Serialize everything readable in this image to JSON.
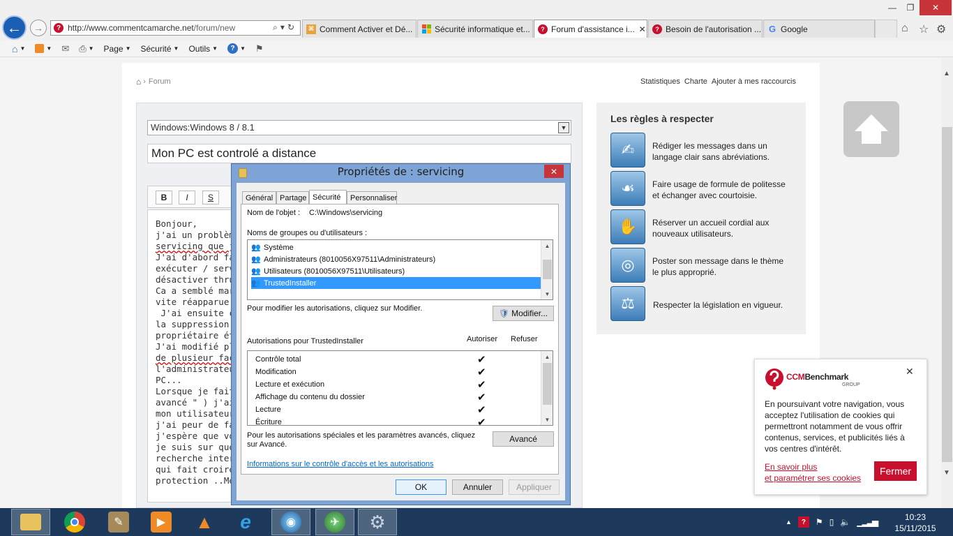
{
  "browser": {
    "window_controls": [
      "—",
      "❐",
      "✕"
    ],
    "address": "http://www.commentcamarche.net/forum/new",
    "address_display_host": "http://www.commentcamarche.net",
    "address_display_path": "/forum/new",
    "tabs": [
      {
        "label": "Comment Activer et Dé...",
        "icon": "ccm-tab-icon",
        "active": false
      },
      {
        "label": "Sécurité informatique et...",
        "icon": "windows-flag-icon",
        "active": false
      },
      {
        "label": "Forum d'assistance i...",
        "icon": "ccm-question-icon",
        "active": true
      },
      {
        "label": "Besoin de l'autorisation ...",
        "icon": "ccm-question-icon",
        "active": false
      },
      {
        "label": "Google",
        "icon": "google-icon",
        "active": false
      }
    ],
    "command_bar": {
      "page": "Page",
      "security": "Sécurité",
      "tools": "Outils"
    }
  },
  "page": {
    "breadcrumb": "Forum",
    "top_links": [
      "Statistiques",
      "Charte",
      "Ajouter à mes raccourcis"
    ],
    "category": "Windows:Windows 8 / 8.1",
    "title": "Mon PC est controlé a distance",
    "format_buttons": [
      "B",
      "I",
      "S"
    ],
    "message_lines": [
      "Bonjour,",
      "j'ai un problème",
      "servicing que je",
      "J'ai d'abord fait:",
      "exécuter / servic",
      "désactiver thrust",
      "Ca a semblé mar",
      "vite réapparue.",
      " J'ai ensuite char",
      "la suppression a",
      "propriétaire était",
      "J'ai modifié plusi",
      "de plusieur facon",
      "l'administrateur",
      "PC...",
      "Lorsque je fait la",
      "avancé \" ) j'ai co",
      "mon utilisateur ,",
      "j'ai peur de faire",
      "j'espère que vou",
      "je suis sur que c'",
      "recherche intern",
      "qui fait croire a m",
      "protection ..Merc"
    ],
    "rules": {
      "title": "Les règles à respecter",
      "items": [
        "Rédiger les messages dans un langage clair sans abréviations.",
        "Faire usage de formule de politesse et échanger avec courtoisie.",
        "Réserver un accueil cordial aux nouveaux utilisateurs.",
        "Poster son message dans le thème le plus approprié.",
        "Respecter la législation en vigueur."
      ]
    },
    "cookie": {
      "brand": "CCMBenchmark",
      "brand_sub": "GROUP",
      "text": "En poursuivant votre navigation, vous acceptez l'utilisation de cookies qui permettront notamment de vous offrir contenus, services, et publicités liés à vos centres d'intérêt.",
      "link_line1": "En savoir plus",
      "link_line2": "et paramétrer ses cookies",
      "button": "Fermer"
    }
  },
  "dialog": {
    "title": "Propriétés de : servicing",
    "tabs": [
      "Général",
      "Partage",
      "Sécurité",
      "Personnaliser"
    ],
    "selected_tab": "Sécurité",
    "object_label": "Nom de l'objet :",
    "object_value": "C:\\Windows\\servicing",
    "groups_label": "Noms de groupes ou d'utilisateurs :",
    "users": [
      "Système",
      "Administrateurs (8010056X97511\\Administrateurs)",
      "Utilisateurs (8010056X97511\\Utilisateurs)",
      "TrustedInstaller"
    ],
    "selected_user": "TrustedInstaller",
    "modify_hint": "Pour modifier les autorisations, cliquez sur Modifier.",
    "modify_button": "Modifier...",
    "permissions_label": "Autorisations pour TrustedInstaller",
    "col_allow": "Autoriser",
    "col_deny": "Refuser",
    "permissions": [
      {
        "name": "Contrôle total",
        "allow": true
      },
      {
        "name": "Modification",
        "allow": true
      },
      {
        "name": "Lecture et exécution",
        "allow": true
      },
      {
        "name": "Affichage du contenu du dossier",
        "allow": true
      },
      {
        "name": "Lecture",
        "allow": true
      },
      {
        "name": "Écriture",
        "allow": true
      }
    ],
    "check_glyph": "✔",
    "advanced_hint": "Pour les autorisations spéciales et les paramètres avancés, cliquez sur Avancé.",
    "advanced_button": "Avancé",
    "access_link": "Informations sur le contrôle d'accès et les autorisations",
    "ok": "OK",
    "cancel": "Annuler",
    "apply": "Appliquer"
  },
  "taskbar": {
    "time": "10:23",
    "date": "15/11/2015"
  }
}
